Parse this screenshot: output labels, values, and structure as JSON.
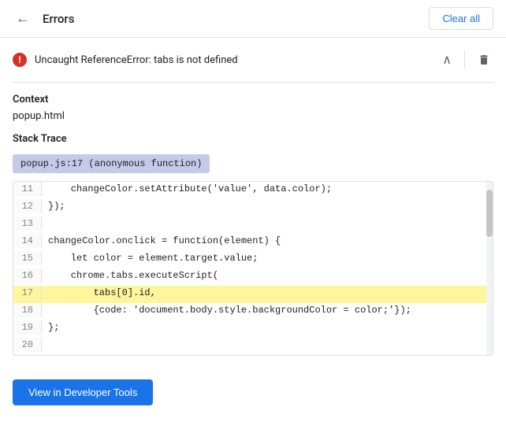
{
  "header": {
    "back_icon": "←",
    "title": "Errors",
    "clear_all_label": "Clear all"
  },
  "error": {
    "icon_label": "!",
    "message": "Uncaught ReferenceError: tabs is not defined",
    "chevron_icon": "∧",
    "delete_icon": "🗑"
  },
  "context": {
    "label": "Context",
    "file": "popup.html"
  },
  "stack_trace": {
    "label": "Stack Trace",
    "chip": "popup.js:17 (anonymous function)"
  },
  "code": {
    "lines": [
      {
        "number": "11",
        "content": "    changeColor.setAttribute('value', data.color);",
        "highlighted": false
      },
      {
        "number": "12",
        "content": "});",
        "highlighted": false
      },
      {
        "number": "13",
        "content": "",
        "highlighted": false
      },
      {
        "number": "14",
        "content": "changeColor.onclick = function(element) {",
        "highlighted": false
      },
      {
        "number": "15",
        "content": "    let color = element.target.value;",
        "highlighted": false
      },
      {
        "number": "16",
        "content": "    chrome.tabs.executeScript(",
        "highlighted": false
      },
      {
        "number": "17",
        "content": "        tabs[0].id,",
        "highlighted": true
      },
      {
        "number": "18",
        "content": "        {code: 'document.body.style.backgroundColor = color;'});",
        "highlighted": false
      },
      {
        "number": "19",
        "content": "};",
        "highlighted": false
      },
      {
        "number": "20",
        "content": "",
        "highlighted": false
      }
    ]
  },
  "footer": {
    "dev_tools_label": "View in Developer Tools"
  }
}
